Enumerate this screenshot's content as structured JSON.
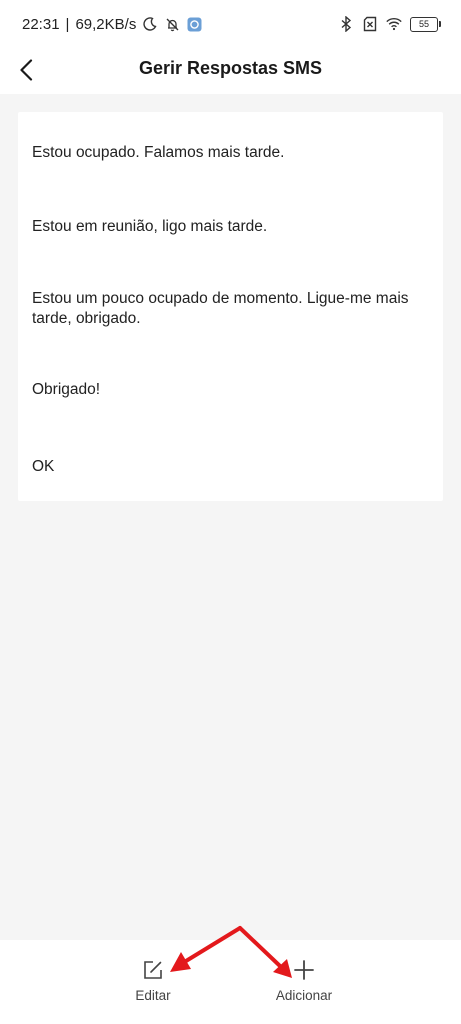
{
  "status_bar": {
    "time": "22:31",
    "separator": "|",
    "speed": "69,2KB/s",
    "battery": "55",
    "icons": [
      "moon-icon",
      "bell-off-icon",
      "app-notification-icon",
      "bluetooth-icon",
      "sim-off-icon",
      "wifi-icon",
      "battery-icon"
    ]
  },
  "header": {
    "title": "Gerir Respostas SMS",
    "back_icon": "chevron-left-icon"
  },
  "replies": [
    "Estou ocupado. Falamos mais tarde.",
    "Estou em reunião, ligo mais tarde.",
    "Estou um pouco ocupado de momento. Ligue-me mais tarde, obrigado.",
    "Obrigado!",
    "OK"
  ],
  "bottom_bar": {
    "edit_label": "Editar",
    "add_label": "Adicionar"
  },
  "annotation": {
    "arrow_color": "#e3191c"
  }
}
